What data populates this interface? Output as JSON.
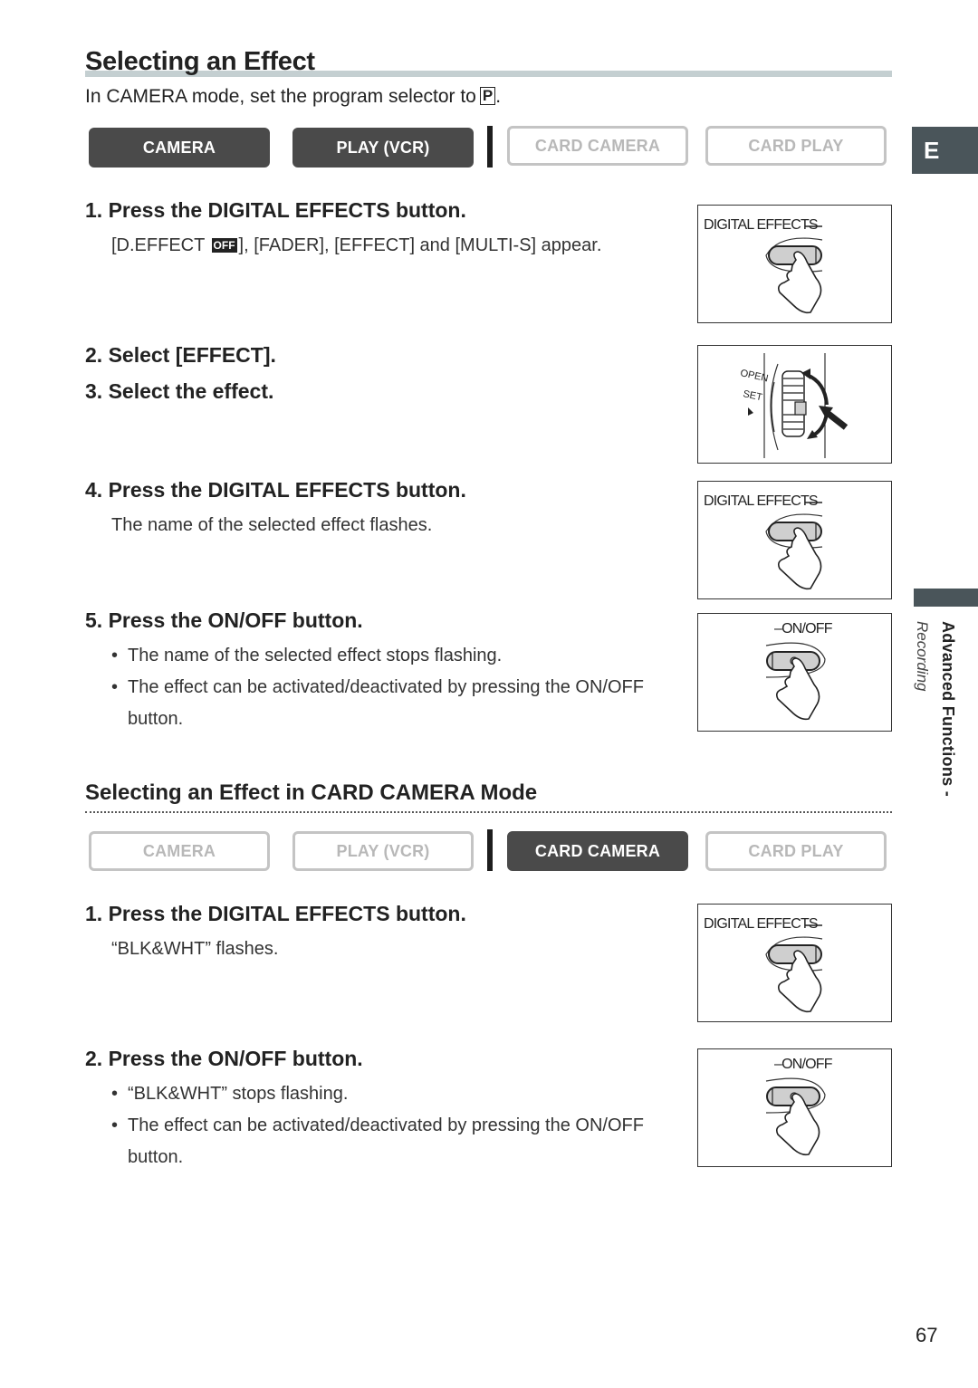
{
  "header": {
    "title": "Selecting an Effect",
    "intro_text": "In CAMERA mode, set the program selector to",
    "program_symbol": "P",
    "intro_end": "."
  },
  "mode_bar_1": {
    "buttons": [
      {
        "label": "CAMERA",
        "active": true
      },
      {
        "label": "PLAY (VCR)",
        "active": true
      },
      {
        "label": "CARD CAMERA",
        "active": false
      },
      {
        "label": "CARD PLAY",
        "active": false
      }
    ]
  },
  "language_tab": "E",
  "section1": {
    "steps": [
      {
        "number": "1.",
        "title": "Press the DIGITAL EFFECTS button.",
        "desc_before": "[D.EFFECT",
        "desc_icon": "OFF",
        "desc_after": "], [FADER], [EFFECT] and [MULTI-S] appear."
      },
      {
        "number": "2.",
        "title": "Select [EFFECT]."
      },
      {
        "number": "3.",
        "title": "Select the effect."
      },
      {
        "number": "4.",
        "title": "Press the DIGITAL EFFECTS button.",
        "desc": "The name of the selected effect flashes."
      },
      {
        "number": "5.",
        "title": "Press the ON/OFF button.",
        "bullets": [
          "The name of the selected effect stops flashing.",
          "The effect can be activated/deactivated by pressing the ON/OFF button."
        ]
      }
    ]
  },
  "subsection": {
    "title": "Selecting an Effect in CARD CAMERA Mode"
  },
  "mode_bar_2": {
    "buttons": [
      {
        "label": "CAMERA",
        "active": false
      },
      {
        "label": "PLAY (VCR)",
        "active": false
      },
      {
        "label": "CARD CAMERA",
        "active": true
      },
      {
        "label": "CARD PLAY",
        "active": false
      }
    ]
  },
  "section2": {
    "steps": [
      {
        "number": "1.",
        "title": "Press the DIGITAL EFFECTS button.",
        "desc": "“BLK&WHT” flashes."
      },
      {
        "number": "2.",
        "title": "Press the ON/OFF button.",
        "bullets": [
          "“BLK&WHT” stops flashing.",
          "The effect can be activated/deactivated by pressing the ON/OFF button."
        ]
      }
    ]
  },
  "illustrations": {
    "digital_effects_label": "DIGITAL EFFECTS",
    "on_off_label": "ON/OFF",
    "dial_labels": [
      "OPEN",
      "SET"
    ]
  },
  "sidebar": {
    "main": "Advanced Functions -",
    "sub": "Recording"
  },
  "bullet_char": "•",
  "page_number": "67"
}
